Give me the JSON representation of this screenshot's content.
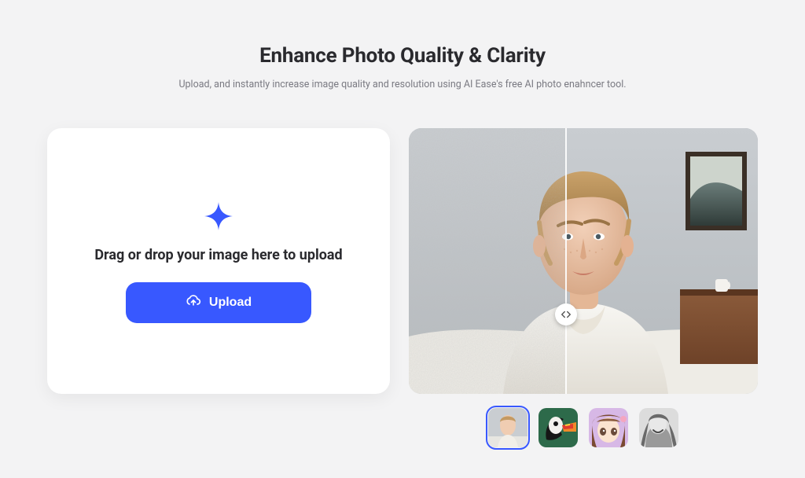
{
  "header": {
    "title": "Enhance Photo Quality & Clarity",
    "subtitle": "Upload, and instantly increase image quality and resolution using AI Ease's free AI photo enahncer tool."
  },
  "upload": {
    "drop_label": "Drag or drop your image here to upload",
    "button_label": "Upload"
  },
  "preview": {
    "slider_position_percent": 45,
    "samples": [
      {
        "name": "portrait-man",
        "active": true
      },
      {
        "name": "puffin-bird",
        "active": false
      },
      {
        "name": "anime-girl",
        "active": false
      },
      {
        "name": "bw-woman",
        "active": false
      }
    ]
  },
  "colors": {
    "accent": "#3858ff",
    "page_bg": "#f3f3f4",
    "card_bg": "#ffffff",
    "text_primary": "#2a2a2e",
    "text_muted": "#7a7a82"
  }
}
